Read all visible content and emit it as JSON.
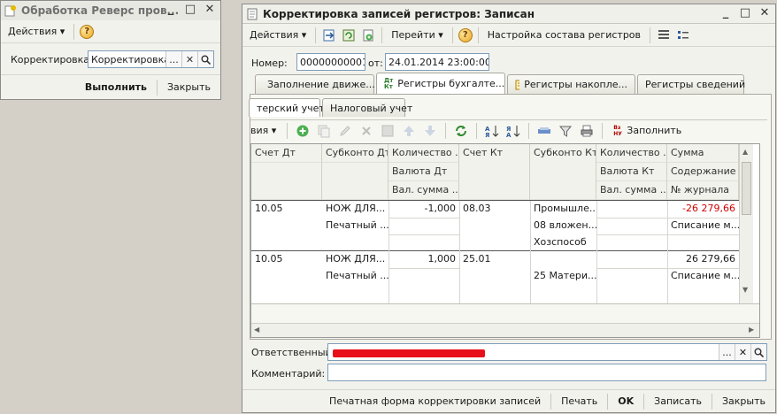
{
  "win1": {
    "title": "Обработка   Реверс пров...",
    "toolbar": {
      "actions": "Действия",
      "help": "?"
    },
    "field_label": "Корректировка:",
    "field_value": "Корректировка за",
    "btn_execute": "Выполнить",
    "btn_close": "Закрыть"
  },
  "win2": {
    "title": "Корректировка записей регистров: Записан",
    "toolbar": {
      "actions": "Действия",
      "goto": "Перейти",
      "help": "?",
      "config": "Настройка состава регистров"
    },
    "number_label": "Номер:",
    "number_value": "00000000001",
    "from_label": "от:",
    "date_value": "24.01.2014 23:00:00",
    "tabs": [
      "Заполнение движе...",
      "Регистры бухгалте...",
      "Регистры накопле...",
      "Регистры сведений"
    ],
    "tab_icon_text": "Дт Кт",
    "subtabs": [
      "терский учет",
      "Налоговый учет"
    ],
    "grid_toolbar": {
      "actions": "вия",
      "fill": "Заполнить",
      "fill_icon_text": "Вз НУ"
    },
    "columns": {
      "r1": [
        "Счет Дт",
        "Субконто Дт",
        "Количество ...",
        "Счет Кт",
        "Субконто Кт",
        "Количество ...",
        "Сумма"
      ],
      "r2": [
        "Валюта Дт",
        "Валюта Кт",
        "Содержание"
      ],
      "r3": [
        "Вал. сумма ...",
        "Вал. сумма ...",
        "№ журнала"
      ]
    },
    "rows": [
      {
        "schet_dt": "10.05",
        "sub_dt": [
          "НОЖ ДЛЯ...",
          "Печатный ..."
        ],
        "kol_dt": "-1,000",
        "schet_kt": "08.03",
        "sub_kt": [
          "Промышле...",
          "08 вложен...",
          "Хозспособ"
        ],
        "summa": "-26 279,66",
        "soderzh": "Списание м..."
      },
      {
        "schet_dt": "10.05",
        "sub_dt": [
          "НОЖ ДЛЯ...",
          "Печатный ..."
        ],
        "kol_dt": "1,000",
        "schet_kt": "25.01",
        "sub_kt": [
          "",
          "25 Матери..."
        ],
        "summa": "26 279,66",
        "soderzh": "Списание м..."
      }
    ],
    "responsible_label": "Ответственный:",
    "comment_label": "Комментарий:",
    "footer": {
      "print_form": "Печатная форма корректировки записей",
      "print": "Печать",
      "ok": "OK",
      "save": "Записать",
      "close": "Закрыть"
    },
    "colors": {
      "redacted": "#e8101a",
      "negative": "#d00000"
    }
  }
}
